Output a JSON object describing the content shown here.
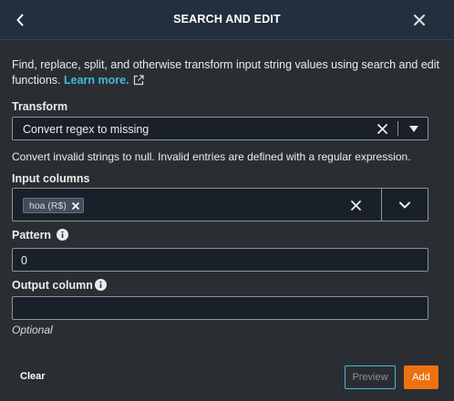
{
  "header": {
    "title": "SEARCH AND EDIT"
  },
  "description": {
    "text": "Find, replace, split, and otherwise transform input string values using search and edit functions.",
    "link_text": "Learn more."
  },
  "transform": {
    "label": "Transform",
    "value": "Convert regex to missing",
    "hint": "Convert invalid strings to null. Invalid entries are defined with a regular expression."
  },
  "input_columns": {
    "label": "Input columns",
    "tokens": [
      "hoa (R$)"
    ]
  },
  "pattern": {
    "label": "Pattern",
    "value": "0"
  },
  "output_column": {
    "label": "Output column",
    "value": "",
    "helper": "Optional"
  },
  "footer": {
    "clear_label": "Clear",
    "preview_label": "Preview",
    "add_label": "Add"
  },
  "colors": {
    "accent": "#ec7211",
    "link": "#44b9d6",
    "background": "#2a2e33",
    "header": "#232f3e"
  },
  "icons": [
    "chevron-left-icon",
    "close-icon",
    "external-link-icon",
    "caret-down-icon",
    "chevron-down-icon",
    "info-icon"
  ]
}
